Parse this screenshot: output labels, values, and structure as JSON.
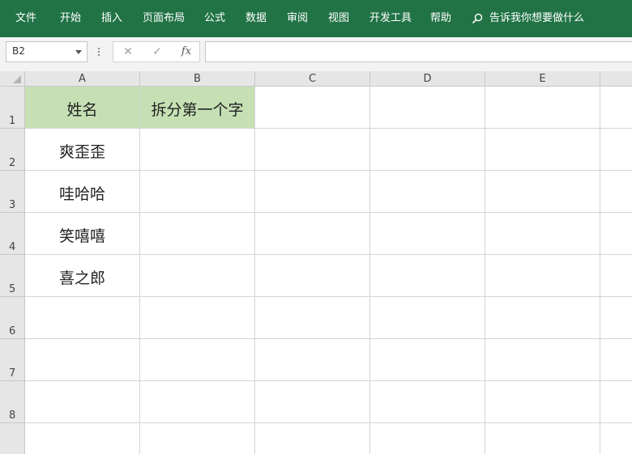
{
  "ribbon": {
    "tabs": [
      "文件",
      "开始",
      "插入",
      "页面布局",
      "公式",
      "数据",
      "审阅",
      "视图",
      "开发工具",
      "帮助"
    ],
    "search_text": "告诉我你想要做什么"
  },
  "formula_bar": {
    "name_box": "B2",
    "cancel_glyph": "✕",
    "enter_glyph": "✓",
    "fx_label": "fx",
    "formula": ""
  },
  "columns": [
    "A",
    "B",
    "C",
    "D",
    "E"
  ],
  "rows": [
    "1",
    "2",
    "3",
    "4",
    "5",
    "6",
    "7",
    "8"
  ],
  "cells": {
    "A1": "姓名",
    "B1": "拆分第一个字",
    "A2": "爽歪歪",
    "A3": "哇哈哈",
    "A4": "笑嘻嘻",
    "A5": "喜之郎"
  },
  "colors": {
    "ribbon": "#217346",
    "header_fill": "#c6e0b4"
  }
}
